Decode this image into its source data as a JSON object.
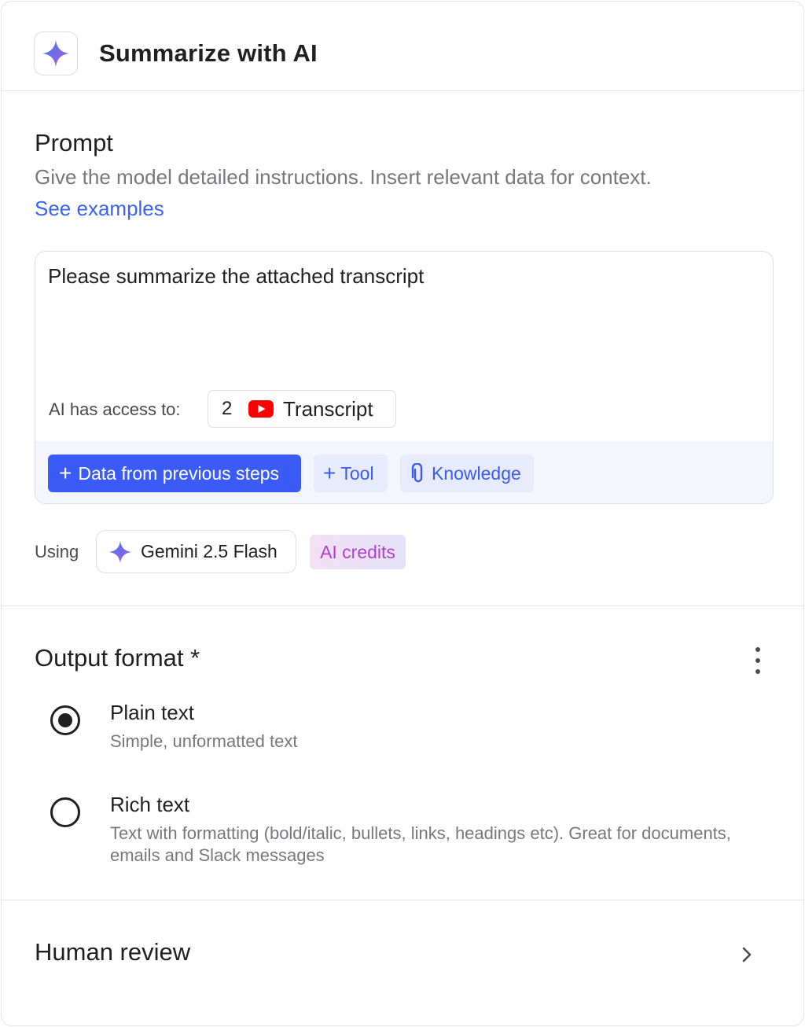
{
  "header": {
    "title": "Summarize with AI",
    "icon": "sparkle-icon"
  },
  "prompt": {
    "title": "Prompt",
    "description": "Give the model detailed instructions. Insert relevant data for context.",
    "examples_link": "See examples",
    "text": "Please summarize the attached transcript",
    "access_label": "AI has access to:",
    "access_item": {
      "count": "2",
      "icon": "youtube-icon",
      "name": "Transcript"
    },
    "toolbar": {
      "data_button": "Data from previous steps",
      "tool_button": "Tool",
      "knowledge_button": "Knowledge"
    },
    "using_label": "Using",
    "model": "Gemini 2.5 Flash",
    "credits_badge": "AI credits"
  },
  "output_format": {
    "title": "Output format *",
    "options": [
      {
        "label": "Plain text",
        "description": "Simple, unformatted text",
        "selected": true
      },
      {
        "label": "Rich text",
        "description": "Text with formatting (bold/italic, bullets, links, headings etc). Great for documents, emails and Slack messages",
        "selected": false
      }
    ]
  },
  "human_review": {
    "title": "Human review"
  },
  "colors": {
    "accent": "#3b5bf6",
    "link": "#3b63f5",
    "credits": "#b13fd0",
    "youtube": "#ff0000"
  }
}
